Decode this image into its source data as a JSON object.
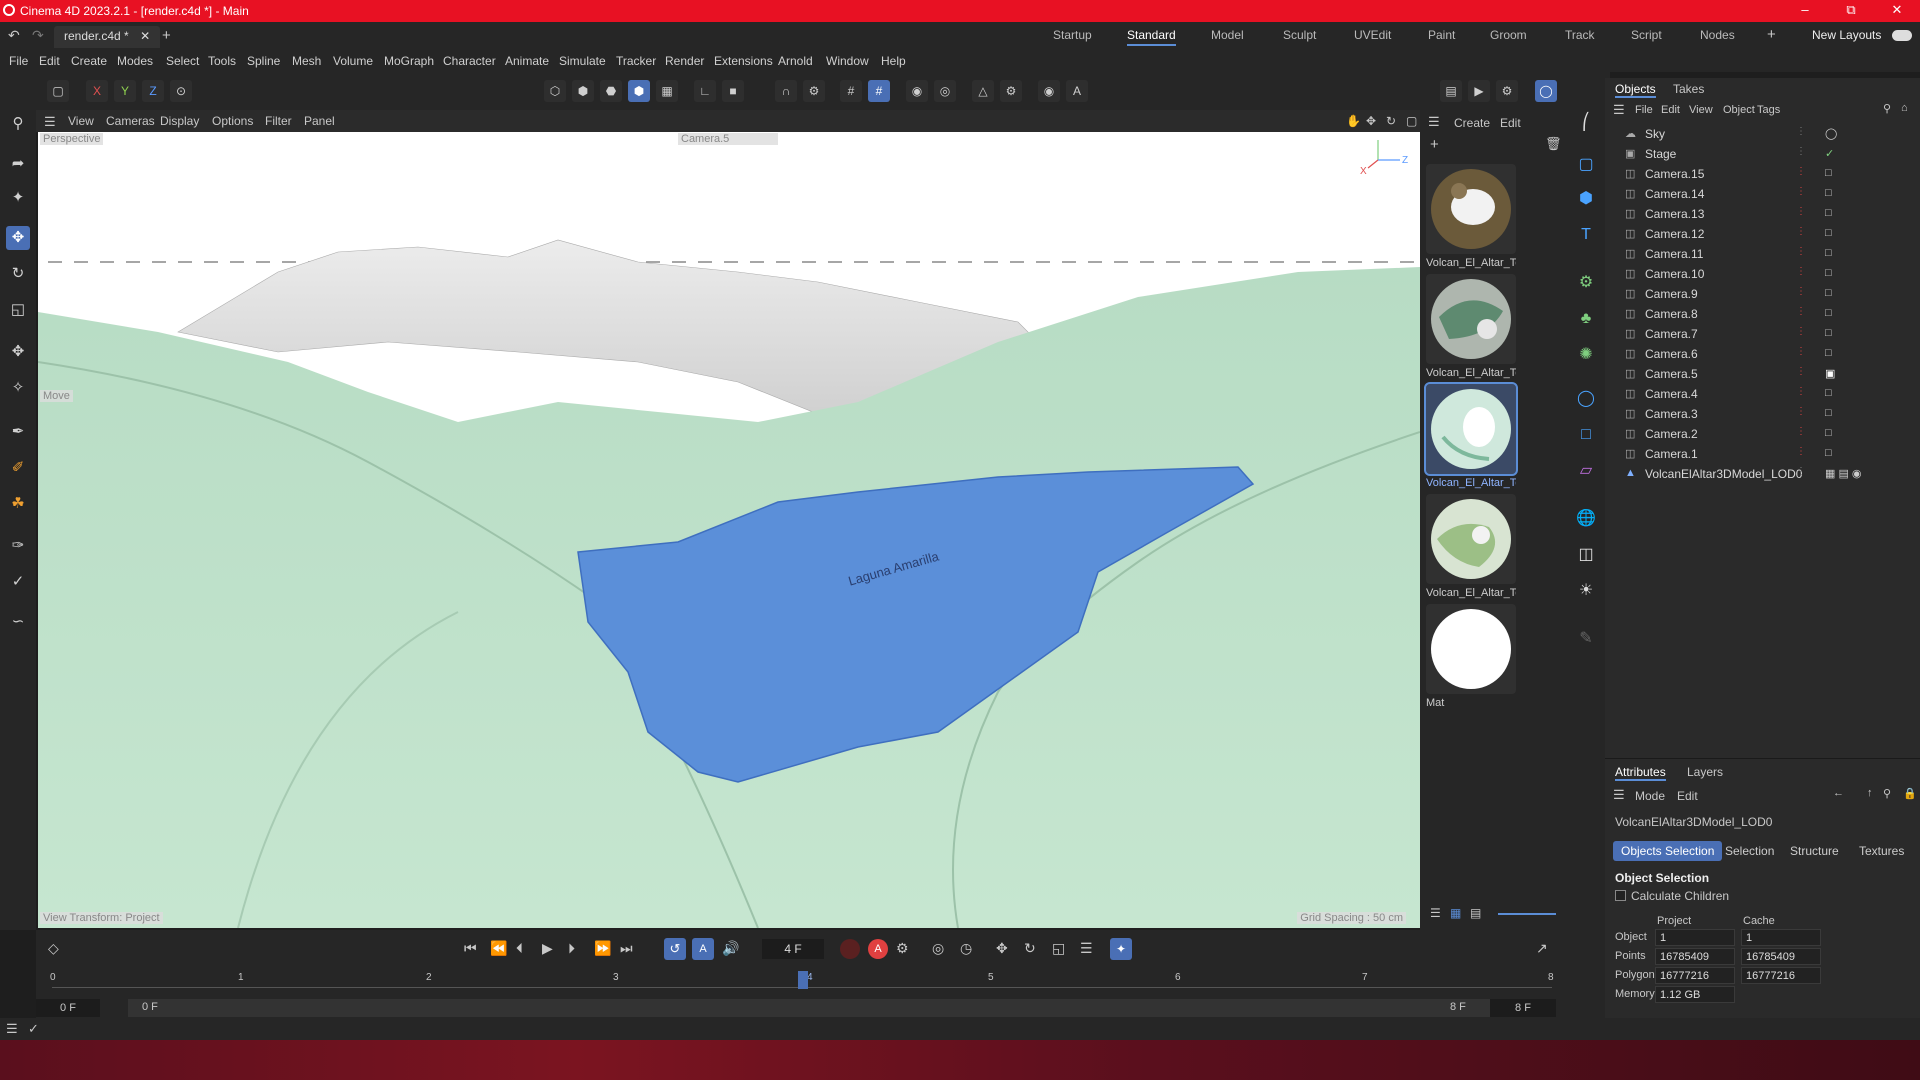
{
  "window": {
    "title": "Cinema 4D 2023.2.1 - [render.c4d *] - Main",
    "minimize_icon": "minimize-icon",
    "restore_icon": "restore-icon",
    "close_icon": "close-icon"
  },
  "tabs": {
    "file_tab": "render.c4d *",
    "layouts": [
      "Startup",
      "Standard",
      "Model",
      "Sculpt",
      "UVEdit",
      "Paint",
      "Groom",
      "Track",
      "Script",
      "Nodes"
    ],
    "active_layout": "Standard",
    "new_layouts": "New Layouts"
  },
  "menu": [
    "File",
    "Edit",
    "Create",
    "Modes",
    "Select",
    "Tools",
    "Spline",
    "Mesh",
    "Volume",
    "MoGraph",
    "Character",
    "Animate",
    "Simulate",
    "Tracker",
    "Render",
    "Extensions",
    "Arnold",
    "Window",
    "Help"
  ],
  "toolbar": {
    "axis_x": "X",
    "axis_y": "Y",
    "axis_z": "Z"
  },
  "viewport": {
    "menu": [
      "View",
      "Cameras",
      "Display",
      "Options",
      "Filter",
      "Panel"
    ],
    "projection_label": "Perspective",
    "camera_label": "Camera.5",
    "tool_label": "Move",
    "view_transform": "View Transform: Project",
    "grid_spacing": "Grid Spacing : 50 cm",
    "lake_text": "Laguna Amarilla"
  },
  "materials": {
    "header": [
      "Create",
      "Edit"
    ],
    "items": [
      {
        "label": "Volcan_El_Altar_Te"
      },
      {
        "label": "Volcan_El_Altar_Te"
      },
      {
        "label": "Volcan_El_Altar_Te"
      },
      {
        "label": "Volcan_El_Altar_Te"
      },
      {
        "label": "Mat"
      }
    ]
  },
  "objects": {
    "tabs": [
      "Objects",
      "Takes"
    ],
    "menu": [
      "File",
      "Edit",
      "View",
      "Object",
      "Tags"
    ],
    "rows": [
      {
        "name": "Sky",
        "icon": "sky-icon"
      },
      {
        "name": "Stage",
        "icon": "stage-icon"
      },
      {
        "name": "Camera.15",
        "icon": "camera-icon"
      },
      {
        "name": "Camera.14",
        "icon": "camera-icon"
      },
      {
        "name": "Camera.13",
        "icon": "camera-icon"
      },
      {
        "name": "Camera.12",
        "icon": "camera-icon"
      },
      {
        "name": "Camera.11",
        "icon": "camera-icon"
      },
      {
        "name": "Camera.10",
        "icon": "camera-icon"
      },
      {
        "name": "Camera.9",
        "icon": "camera-icon"
      },
      {
        "name": "Camera.8",
        "icon": "camera-icon"
      },
      {
        "name": "Camera.7",
        "icon": "camera-icon"
      },
      {
        "name": "Camera.6",
        "icon": "camera-icon"
      },
      {
        "name": "Camera.5",
        "icon": "camera-icon"
      },
      {
        "name": "Camera.4",
        "icon": "camera-icon"
      },
      {
        "name": "Camera.3",
        "icon": "camera-icon"
      },
      {
        "name": "Camera.2",
        "icon": "camera-icon"
      },
      {
        "name": "Camera.1",
        "icon": "camera-icon"
      },
      {
        "name": "VolcanElAltar3DModel_LOD0",
        "icon": "polygon-object-icon"
      }
    ]
  },
  "attributes": {
    "tabs": [
      "Attributes",
      "Layers"
    ],
    "menu": [
      "Mode",
      "Edit"
    ],
    "object_name": "VolcanElAltar3DModel_LOD0",
    "sub_tabs": [
      "Objects Selection",
      "Selection",
      "Structure",
      "Textures"
    ],
    "section": "Object Selection",
    "calc_children": "Calculate Children",
    "col_project": "Project",
    "col_cache": "Cache",
    "rows": [
      {
        "label": "Object",
        "project": "1",
        "cache": "1"
      },
      {
        "label": "Points",
        "project": "16785409",
        "cache": "16785409"
      },
      {
        "label": "Polygons",
        "project": "16777216",
        "cache": "16777216"
      },
      {
        "label": "Memory",
        "project": "1.12 GB",
        "cache": ""
      }
    ]
  },
  "timeline": {
    "current_frame": "4 F",
    "ticks": [
      "0",
      "1",
      "2",
      "3",
      "4",
      "5",
      "6",
      "7",
      "8"
    ],
    "start": "0 F",
    "range_start": "0 F",
    "range_end": "8 F",
    "end": "8 F"
  },
  "colors": {
    "title_bar": "#e81123",
    "accent": "#4a6fb5",
    "terrain": "#bfe0c8",
    "water": "#5b8fd9"
  }
}
